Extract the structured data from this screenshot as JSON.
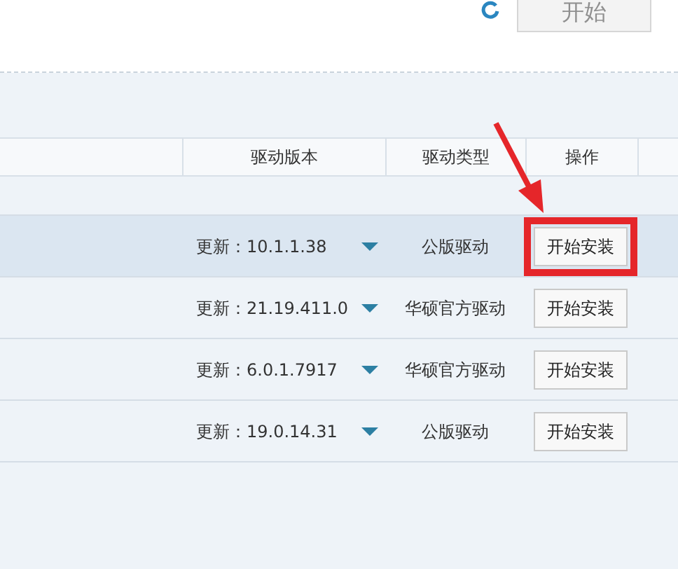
{
  "toolbar": {
    "start_button": "开始"
  },
  "table": {
    "columns": [
      "驱动版本",
      "驱动类型",
      "操作"
    ],
    "rows": [
      {
        "version": "更新：10.1.1.38",
        "type": "公版驱动",
        "action": "开始安装",
        "selected": true,
        "annotated": true
      },
      {
        "version": "更新：21.19.411.0",
        "type": "华硕官方驱动",
        "action": "开始安装",
        "selected": false,
        "annotated": false
      },
      {
        "version": "更新：6.0.1.7917",
        "type": "华硕官方驱动",
        "action": "开始安装",
        "selected": false,
        "annotated": false
      },
      {
        "version": "更新：19.0.14.31",
        "type": "公版驱动",
        "action": "开始安装",
        "selected": false,
        "annotated": false
      }
    ]
  }
}
